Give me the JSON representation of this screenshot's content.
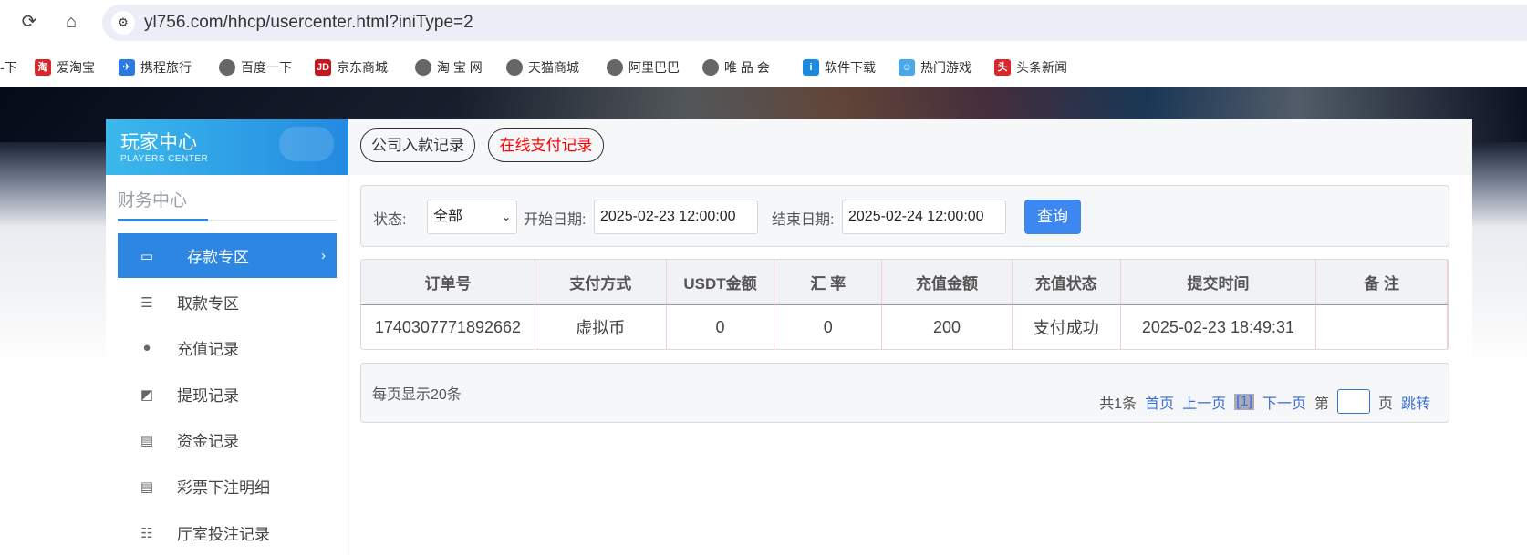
{
  "browser": {
    "url": "yl756.com/hhcp/usercenter.html?iniType=2",
    "bookmarks": [
      {
        "label": "-下",
        "icon": "partial"
      },
      {
        "label": "爱淘宝",
        "icon": "taobao-icon",
        "badge": "淘",
        "color": "#d8262b"
      },
      {
        "label": "携程旅行",
        "icon": "ctrip-icon",
        "badge": "✈",
        "color": "#2a7ae2"
      },
      {
        "label": "百度一下",
        "icon": "globe-icon"
      },
      {
        "label": "京东商城",
        "icon": "jd-icon",
        "badge": "JD",
        "color": "#c8161d"
      },
      {
        "label": "淘 宝 网",
        "icon": "globe-icon"
      },
      {
        "label": "天猫商城",
        "icon": "globe-icon"
      },
      {
        "label": "阿里巴巴",
        "icon": "globe-icon"
      },
      {
        "label": "唯 品 会",
        "icon": "globe-icon"
      },
      {
        "label": "软件下载",
        "icon": "download-icon",
        "badge": "i",
        "color": "#1a8ae0"
      },
      {
        "label": "热门游戏",
        "icon": "game-icon",
        "badge": "☺",
        "color": "#4aa8e8"
      },
      {
        "label": "头条新闻",
        "icon": "toutiao-icon",
        "badge": "头",
        "color": "#d8262b"
      }
    ]
  },
  "sidebar": {
    "title": "玩家中心",
    "subtitle": "PLAYERS CENTER",
    "section": "财务中心",
    "items": [
      {
        "label": "存款专区",
        "icon": "card-icon",
        "active": true
      },
      {
        "label": "取款专区",
        "icon": "hand-cash-icon"
      },
      {
        "label": "充值记录",
        "icon": "money-bag-icon"
      },
      {
        "label": "提现记录",
        "icon": "wallet-icon"
      },
      {
        "label": "资金记录",
        "icon": "cash-icon"
      },
      {
        "label": "彩票下注明细",
        "icon": "list-icon"
      },
      {
        "label": "厅室投注记录",
        "icon": "list-bullets-icon"
      }
    ]
  },
  "tabs": [
    {
      "label": "公司入款记录",
      "color": "#333333"
    },
    {
      "label": "在线支付记录",
      "color": "#ff0000",
      "active": true
    }
  ],
  "filter": {
    "status_label": "状态:",
    "status_value": "全部",
    "start_label": "开始日期:",
    "start_value": "2025-02-23 12:00:00",
    "end_label": "结束日期:",
    "end_value": "2025-02-24 12:00:00",
    "query": "查询"
  },
  "table": {
    "headers": [
      "订单号",
      "支付方式",
      "USDT金额",
      "汇 率",
      "充值金额",
      "充值状态",
      "提交时间",
      "备 注"
    ],
    "rows": [
      [
        "1740307771892662",
        "虚拟币",
        "0",
        "0",
        "200",
        "支付成功",
        "2025-02-23 18:49:31",
        ""
      ]
    ]
  },
  "pager": {
    "per_page": "每页显示20条",
    "total": "共1条",
    "first": "首页",
    "prev": "上一页",
    "current": "[1]",
    "next": "下一页",
    "di": "第",
    "ye": "页",
    "jump": "跳转"
  }
}
